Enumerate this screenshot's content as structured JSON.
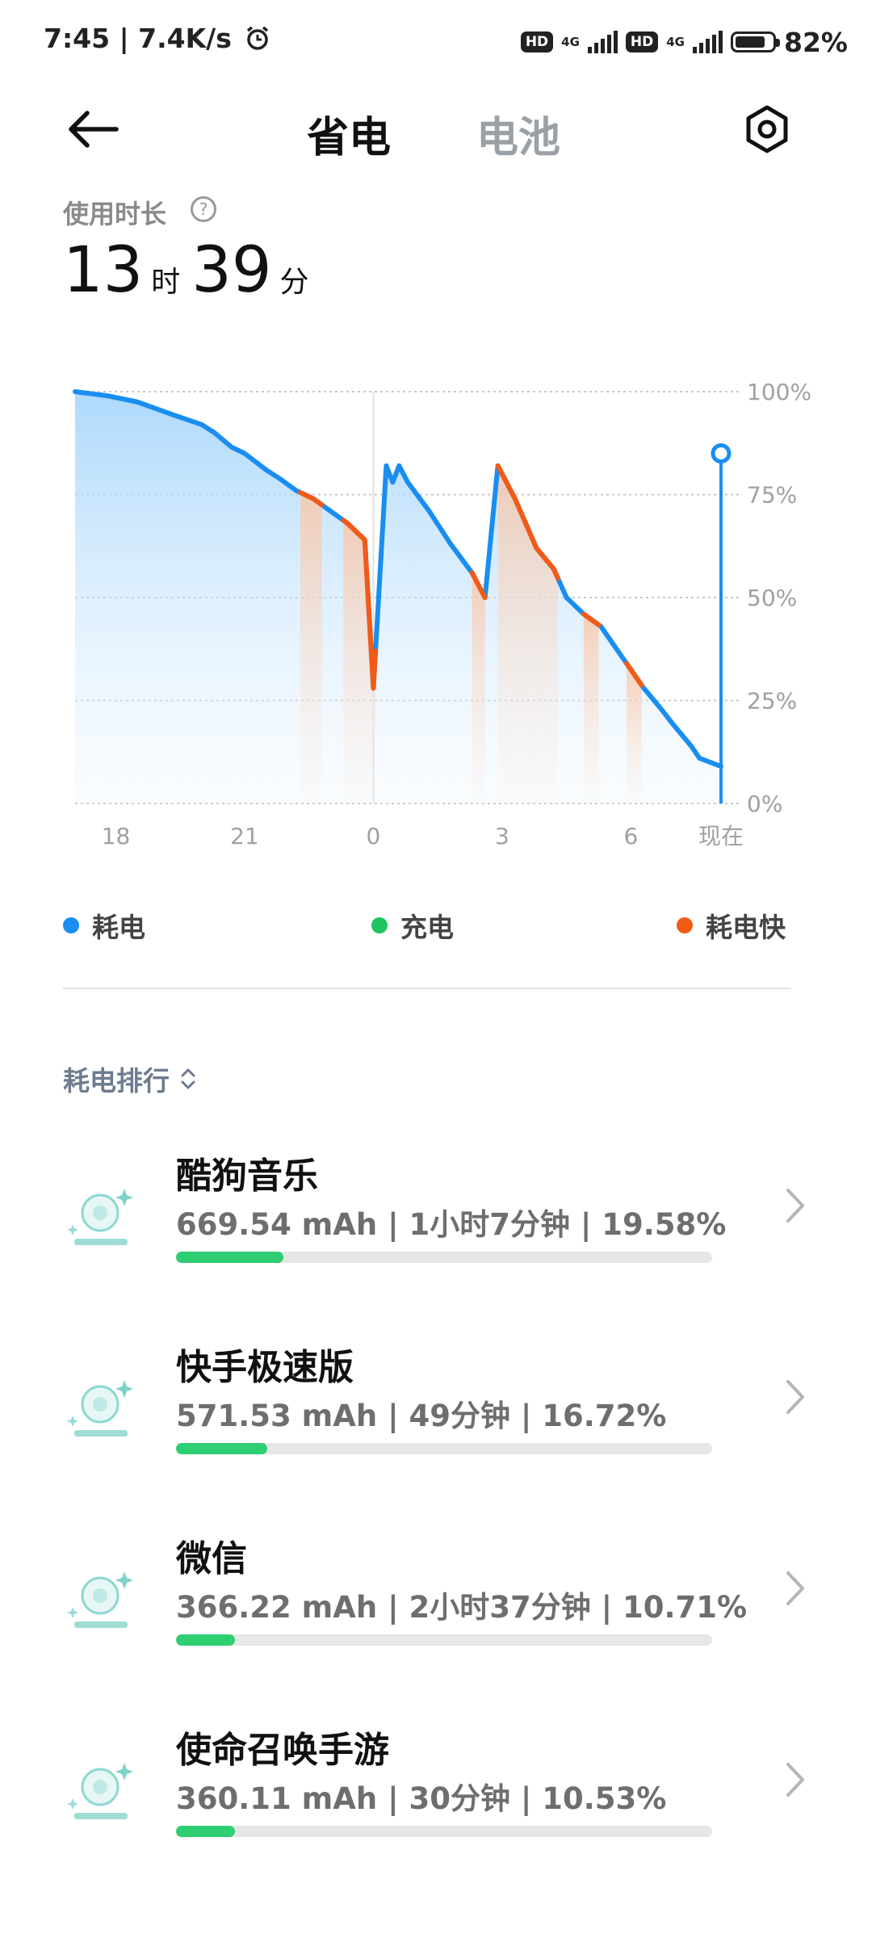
{
  "status_bar": {
    "time": "7:45 | 7.4K/s",
    "hd1": "HD",
    "net1": "4G",
    "hd2": "HD",
    "net2": "4G",
    "battery_percent": "82%",
    "battery_level": 82,
    "icons": [
      "alarm-icon",
      "signal-icon",
      "battery-icon"
    ]
  },
  "header": {
    "tabs": [
      {
        "label": "省电",
        "active": true
      },
      {
        "label": "电池",
        "active": false
      }
    ],
    "icons": [
      "back-arrow-icon",
      "settings-icon"
    ]
  },
  "usage": {
    "label": "使用时长",
    "help_icon": "?",
    "hours": "13",
    "hours_unit": "时",
    "minutes": "39",
    "minutes_unit": "分"
  },
  "chart_data": {
    "type": "line",
    "y_ticks": [
      "100%",
      "75%",
      "50%",
      "25%",
      "0%"
    ],
    "ylim": [
      0,
      100
    ],
    "x_ticks": [
      {
        "label": "18",
        "x": 18
      },
      {
        "label": "21",
        "x": 21
      },
      {
        "label": "0",
        "x": 24
      },
      {
        "label": "3",
        "x": 27
      },
      {
        "label": "6",
        "x": 30
      },
      {
        "label": "现在",
        "x": 32.1
      }
    ],
    "xlim": [
      17.05,
      32.1
    ],
    "grid": true,
    "series": [
      {
        "name": "耗电",
        "color": "#1a8ef0",
        "x": [
          17.05,
          17.8,
          18.5,
          19.3,
          20.0,
          20.3,
          20.7,
          21.0,
          21.5,
          21.8,
          22.2,
          22.6,
          23.0,
          23.4,
          23.8,
          24.0,
          24.3,
          24.45,
          24.6,
          24.8,
          25.3,
          25.8,
          26.3,
          26.6,
          26.9,
          27.3,
          27.8,
          28.2,
          28.5,
          28.9,
          29.3,
          29.9,
          30.3,
          30.7,
          31.0,
          31.4,
          31.6,
          32.1
        ],
        "y": [
          100,
          99,
          97.5,
          94.5,
          92,
          90,
          86.5,
          85,
          81,
          79,
          76,
          74,
          71,
          68,
          64,
          28,
          82,
          78,
          82,
          78,
          71,
          63,
          56,
          50,
          82,
          74,
          62,
          57,
          50,
          46,
          43,
          34,
          28,
          23,
          19,
          14,
          11,
          9
        ]
      },
      {
        "name": "耗电快",
        "color": "#f35a16",
        "segments": [
          {
            "from": 22.3,
            "to": 22.8
          },
          {
            "from": 23.3,
            "to": 24.05
          },
          {
            "from": 26.3,
            "to": 26.6
          },
          {
            "from": 26.9,
            "to": 28.3
          },
          {
            "from": 28.9,
            "to": 29.25
          },
          {
            "from": 29.9,
            "to": 30.25
          }
        ]
      },
      {
        "name": "充电",
        "color": "#1ec460"
      }
    ],
    "current_point": {
      "x": 32.1,
      "y": 85
    },
    "legend": [
      {
        "label": "耗电",
        "color": "#1a8ef0"
      },
      {
        "label": "充电",
        "color": "#1ec460"
      },
      {
        "label": "耗电快",
        "color": "#f35a16"
      }
    ]
  },
  "ranking": {
    "label": "耗电排行",
    "sort_icon": "sort-toggle-icon",
    "items": [
      {
        "name": "酷狗音乐",
        "stats": "669.54 mAh | 1小时7分钟 | 19.58%",
        "percent": 19.58,
        "bar_fraction": 0.2
      },
      {
        "name": "快手极速版",
        "stats": "571.53 mAh | 49分钟 | 16.72%",
        "percent": 16.72,
        "bar_fraction": 0.17
      },
      {
        "name": "微信",
        "stats": "366.22 mAh | 2小时37分钟 | 10.71%",
        "percent": 10.71,
        "bar_fraction": 0.11
      },
      {
        "name": "使命召唤手游",
        "stats": "360.11 mAh | 30分钟 | 10.53%",
        "percent": 10.53,
        "bar_fraction": 0.11
      }
    ]
  },
  "colors": {
    "accent_blue": "#1a8ef0",
    "fast_orange": "#f35a16",
    "charge_green": "#1ec460",
    "bar_green": "#2fce73"
  }
}
